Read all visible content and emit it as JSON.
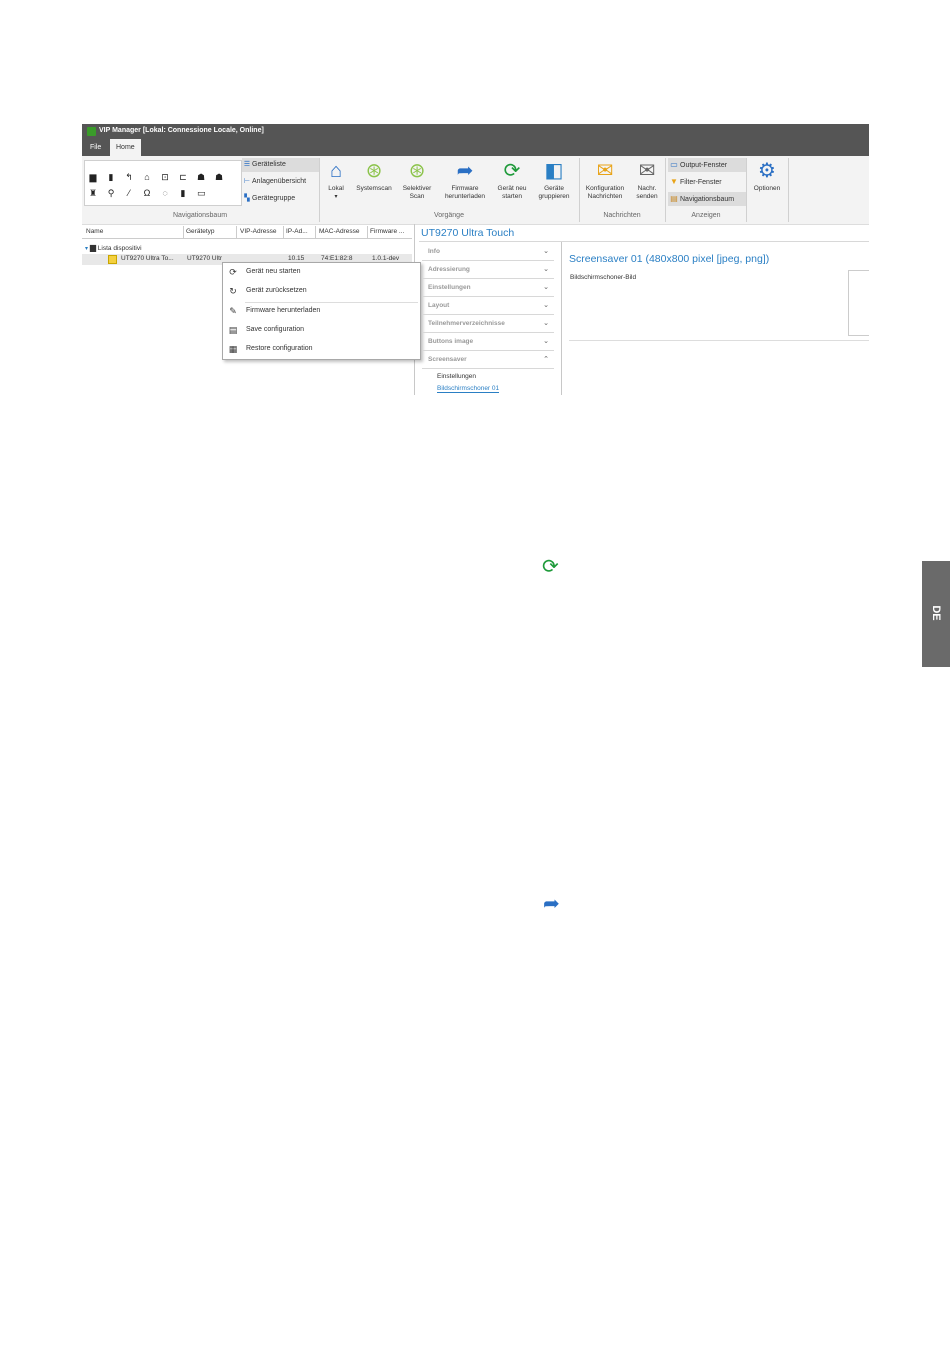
{
  "window": {
    "title": "VIP Manager [Lokal: Connessione Locale, Online]"
  },
  "tabs": {
    "file": "File",
    "home": "Home"
  },
  "ribbon": {
    "nav_group_label": "Navigationsbaum",
    "nav_list": [
      "Geräteliste",
      "Anlagenübersicht",
      "Gerätegruppe"
    ],
    "vorgaenge_label": "Vorgänge",
    "buttons": {
      "lokal": "Lokal",
      "systemscan": "Systemscan",
      "selektiver_scan_1": "Selektiver",
      "selektiver_scan_2": "Scan",
      "firmware_1": "Firmware",
      "firmware_2": "herunterladen",
      "neustart_1": "Gerät neu",
      "neustart_2": "starten",
      "gruppieren_1": "Geräte",
      "gruppieren_2": "gruppieren"
    },
    "nachrichten_label": "Nachrichten",
    "konfiguration_1": "Konfiguration",
    "konfiguration_2": "Nachrichten",
    "nachr_senden_1": "Nachr.",
    "nachr_senden_2": "senden",
    "anzeigen_label": "Anzeigen",
    "anzeigen": [
      "Output-Fenster",
      "Filter-Fenster",
      "Navigationsbaum"
    ],
    "optionen": "Optionen"
  },
  "grid": {
    "columns": [
      "Name",
      "Gerätetyp",
      "VIP-Adresse",
      "IP-Ad...",
      "MAC-Adresse",
      "Firmware ..."
    ],
    "root": "Lista dispositivi",
    "device": {
      "name": "UT9270 Ultra To...",
      "type": "UT9270 Ultr",
      "ip": "10.15",
      "mac": "74:E1:82:8",
      "firmware": "1.0.1-dev"
    }
  },
  "context_menu": [
    "Gerät neu starten",
    "Gerät zurücksetzen",
    "Firmware herunterladen",
    "Save configuration",
    "Restore configuration"
  ],
  "detail": {
    "device_title": "UT9270 Ultra Touch",
    "sections": [
      "Info",
      "Adressierung",
      "Einstellungen",
      "Layout",
      "Teilnehmerverzeichnisse",
      "Buttons image",
      "Screensaver"
    ],
    "screensaver_items": [
      "Einstellungen",
      "Bildschirmschoner 01"
    ],
    "panel_title": "Screensaver 01 (480x800 pixel [jpeg, png])",
    "panel_label": "Bildschirmschoner-Bild"
  },
  "side_tab": "DE",
  "colors": {
    "accent": "#2a7fc4",
    "refresh_green": "#1e9a3a",
    "titlebar": "#555555"
  }
}
